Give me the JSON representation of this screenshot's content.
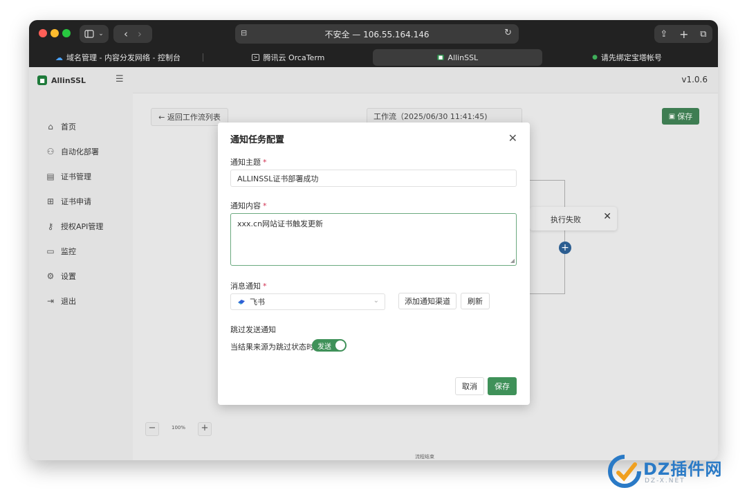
{
  "browser": {
    "address": "不安全 — 106.55.164.146",
    "tabs": [
      {
        "label": "域名管理 - 内容分发网络 - 控制台"
      },
      {
        "label": "腾讯云 OrcaTerm"
      },
      {
        "label": "AllinSSL"
      },
      {
        "label": "请先绑定宝塔帐号"
      }
    ]
  },
  "app": {
    "logo": "AllinSSL",
    "version": "v1.0.6",
    "nav": [
      {
        "label": "首页"
      },
      {
        "label": "自动化部署"
      },
      {
        "label": "证书管理"
      },
      {
        "label": "证书申请"
      },
      {
        "label": "授权API管理"
      },
      {
        "label": "监控"
      },
      {
        "label": "设置"
      },
      {
        "label": "退出"
      }
    ],
    "back_label": "← 返回工作流列表",
    "workflow_name": "工作流（2025/06/30 11:41:45)",
    "save_label": "保存",
    "fail_node": "执行失败",
    "flow_end": "流程结束",
    "zoom": "100%"
  },
  "modal": {
    "title": "通知任务配置",
    "subject_label": "通知主题",
    "subject_value": "ALLINSSL证书部署成功",
    "content_label": "通知内容",
    "content_value": "xxx.cn网站证书触发更新",
    "channel_label": "消息通知",
    "channel_value": "飞书",
    "add_channel": "添加通知渠道",
    "refresh": "刷新",
    "skip_label": "跳过发送通知",
    "skip_desc": "当结果来源为跳过状态时",
    "toggle_text": "发送",
    "cancel": "取消",
    "save": "保存"
  },
  "watermark": {
    "text": "DZ插件网",
    "sub": "DZ-X.NET"
  },
  "colors": {
    "accent": "#3f9159",
    "required": "#d03050",
    "node_blue": "#2c5e91"
  }
}
